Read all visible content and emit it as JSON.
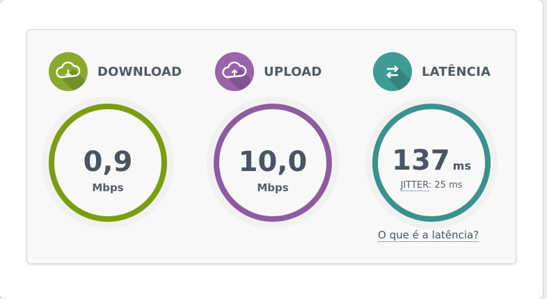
{
  "colors": {
    "download": "#7a9e10",
    "download_icon": "#8aaa2f",
    "upload": "#8e5ba0",
    "upload_icon": "#9a63ac",
    "latency": "#3a9190",
    "latency_icon": "#3f9b95"
  },
  "download": {
    "title": "DOWNLOAD",
    "icon": "cloud-download-icon",
    "value": "0,9",
    "unit": "Mbps"
  },
  "upload": {
    "title": "UPLOAD",
    "icon": "cloud-upload-icon",
    "value": "10,0",
    "unit": "Mbps"
  },
  "latency": {
    "title": "LATÊNCIA",
    "icon": "swap-arrows-icon",
    "value": "137",
    "unit": "ms",
    "jitter_label": "JITTER",
    "jitter_value": ": 25 ms",
    "help_link": "O que é a latência?"
  }
}
